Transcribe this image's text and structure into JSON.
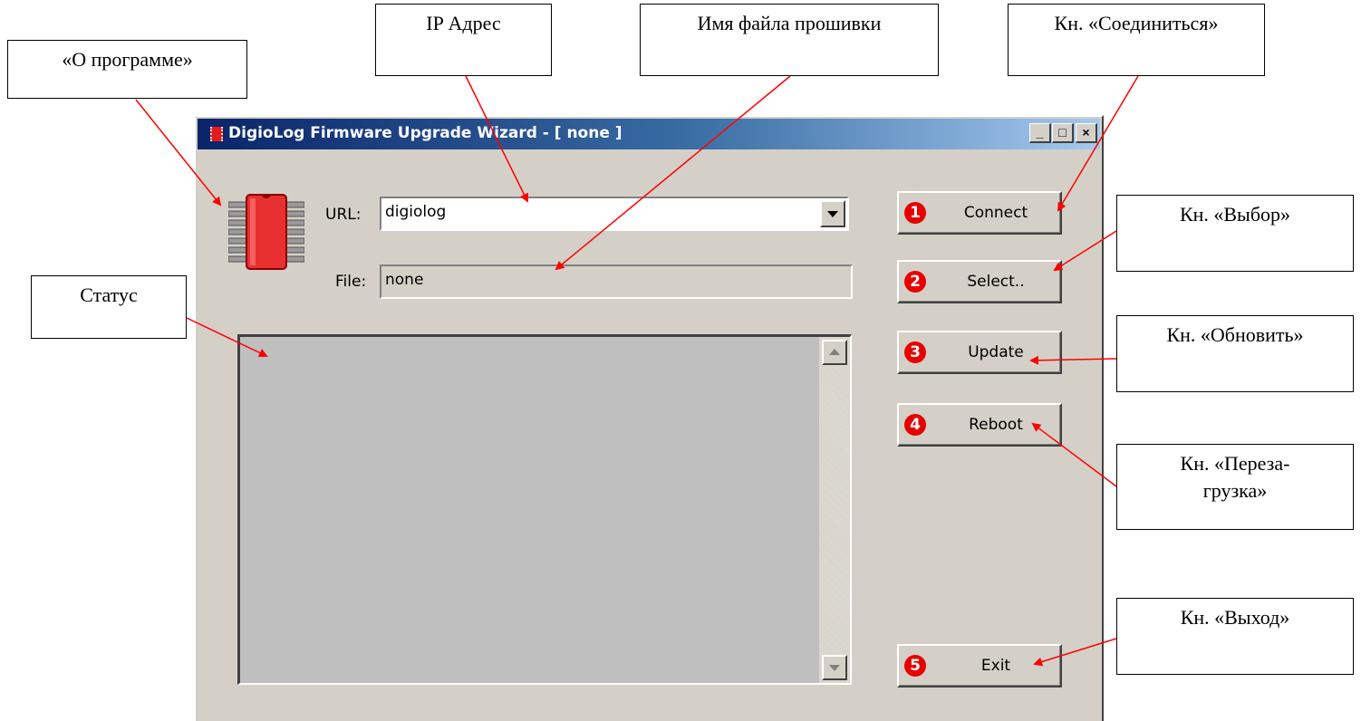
{
  "window": {
    "title": "DigioLog Firmware Upgrade Wizard - [ none ]",
    "controls": [
      "_",
      "□",
      "×"
    ]
  },
  "form": {
    "url_label": "URL:",
    "url_value": "digiolog",
    "file_label": "File:",
    "file_value": "none"
  },
  "buttons": [
    {
      "number": "1",
      "label": "Connect"
    },
    {
      "number": "2",
      "label": "Select.."
    },
    {
      "number": "3",
      "label": "Update"
    },
    {
      "number": "4",
      "label": "Reboot"
    },
    {
      "number": "5",
      "label": "Exit"
    }
  ],
  "callouts": {
    "about": "«О программе»",
    "ip": "IP Адрес",
    "firmware": "Имя файла прошивки",
    "connect": "Кн. «Соединиться»",
    "select": "Кн. «Выбор»",
    "status": "Статус",
    "update": "Кн. «Обновить»",
    "reboot": "Кн. «Переза-грузка»",
    "exit": "Кн. «Выход»"
  },
  "icons": {
    "app_icon": "chip-icon",
    "dropdown": "chevron-down-icon",
    "scroll_up": "arrow-up-icon",
    "scroll_down": "arrow-down-icon"
  },
  "colors": {
    "title_gradient_start": "#0a246a",
    "title_gradient_end": "#a6caf0",
    "window_face": "#d4d0c8",
    "status_area": "#bfbfbf",
    "number_badge": "#e80000",
    "arrow": "#ff0000"
  }
}
